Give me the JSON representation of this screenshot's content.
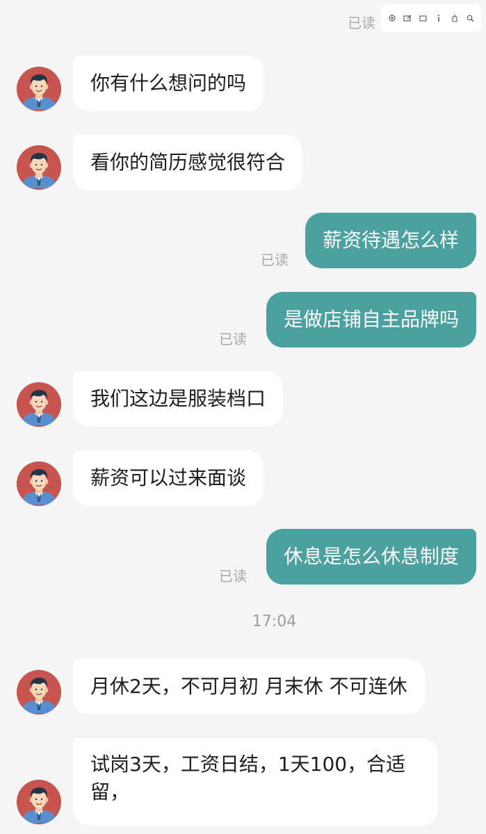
{
  "top": {
    "read_label": "已读"
  },
  "toolbar": {
    "icons": [
      "screenshot-icon",
      "edit-icon",
      "window-icon",
      "info-icon",
      "pin-icon",
      "search-icon"
    ]
  },
  "messages": [
    {
      "side": "in",
      "text": "你有什么想问的吗"
    },
    {
      "side": "in",
      "text": "看你的简历感觉很符合"
    },
    {
      "side": "out",
      "text": "薪资待遇怎么样",
      "status": "已读"
    },
    {
      "side": "out",
      "text": "是做店铺自主品牌吗",
      "status": "已读"
    },
    {
      "side": "in",
      "text": "我们这边是服装档口"
    },
    {
      "side": "in",
      "text": "薪资可以过来面谈"
    },
    {
      "side": "out",
      "text": "休息是怎么休息制度",
      "status": "已读"
    },
    {
      "side": "in",
      "text": "月休2天，不可月初 月末休 不可连休"
    },
    {
      "side": "in",
      "text": "试岗3天，工资日结，1天100，合适留，"
    }
  ],
  "timestamp": "17:04",
  "colors": {
    "background": "#f5f5f5",
    "outgoing_bubble": "#4ba0a0",
    "incoming_bubble": "#ffffff",
    "avatar_bg": "#c85450"
  }
}
